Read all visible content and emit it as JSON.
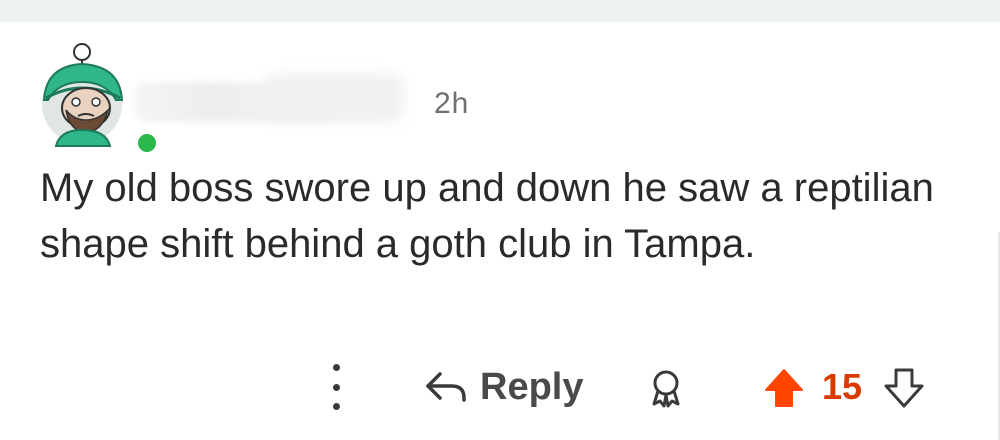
{
  "comment": {
    "username": "",
    "timestamp": "2h",
    "body": "My old boss swore up and down he saw a reptilian shape shift behind a goth club in Tampa."
  },
  "actions": {
    "reply_label": "Reply",
    "score": "15"
  },
  "colors": {
    "online": "#2db84b",
    "upvote": "#ff4500",
    "score": "#d93a00",
    "avatar_bg": "#39b98a"
  },
  "icons": {
    "more": "more-vertical-icon",
    "reply": "reply-arrow-icon",
    "award": "award-icon",
    "upvote": "upvote-arrow-icon",
    "downvote": "downvote-arrow-icon"
  }
}
